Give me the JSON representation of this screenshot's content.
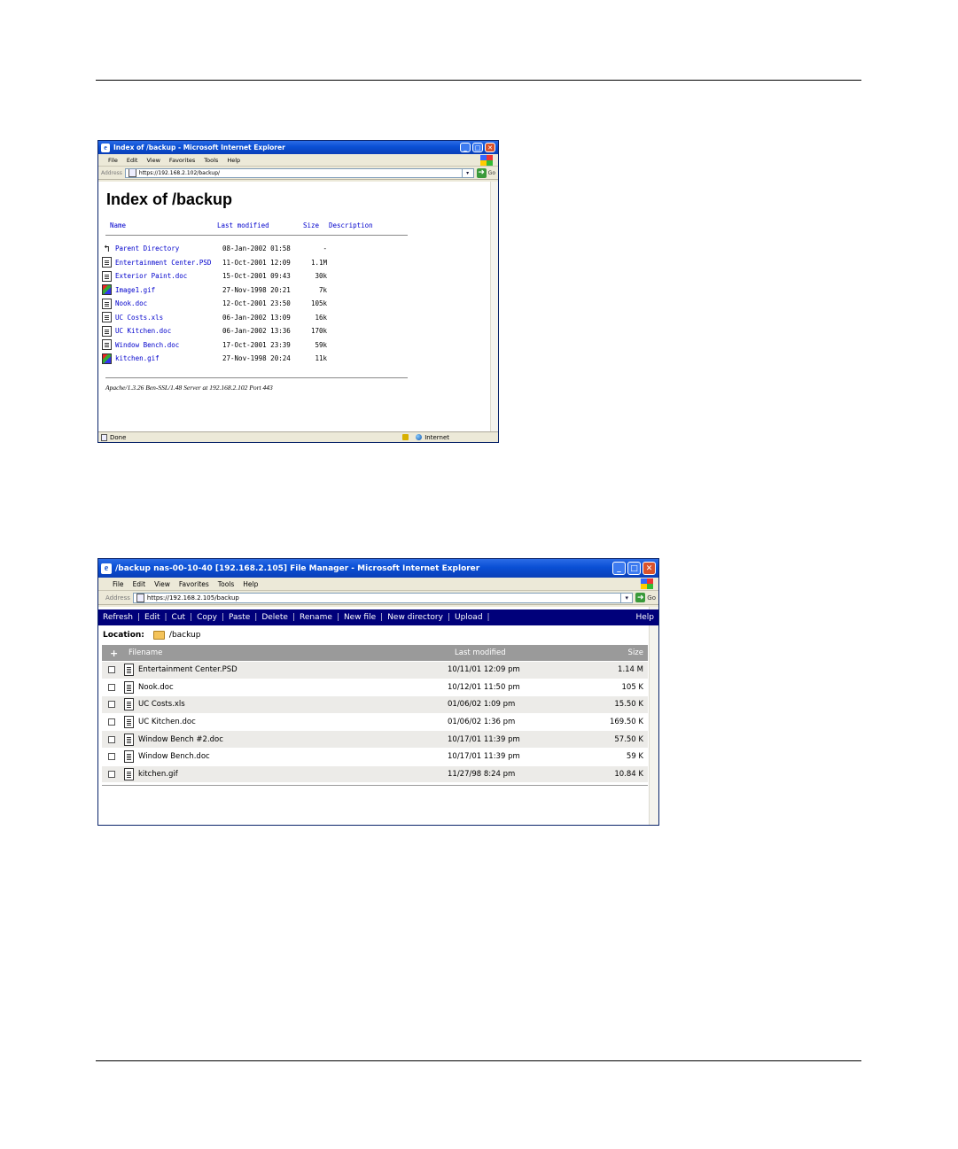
{
  "window1": {
    "title": "Index of /backup - Microsoft Internet Explorer",
    "menu": [
      "File",
      "Edit",
      "View",
      "Favorites",
      "Tools",
      "Help"
    ],
    "address_label": "Address",
    "address": "https://192.168.2.102/backup/",
    "go_label": "Go",
    "heading": "Index of /backup",
    "columns": {
      "name": "Name",
      "modified": "Last modified",
      "size": "Size",
      "description": "Description"
    },
    "rows": [
      {
        "icon": "back",
        "name": "Parent Directory",
        "modified": "08-Jan-2002 01:58",
        "size": "-"
      },
      {
        "icon": "doc",
        "name": "Entertainment Center.PSD",
        "modified": "11-Oct-2001 12:09",
        "size": "1.1M"
      },
      {
        "icon": "doc",
        "name": "Exterior Paint.doc",
        "modified": "15-Oct-2001 09:43",
        "size": "30k"
      },
      {
        "icon": "image",
        "name": "Image1.gif",
        "modified": "27-Nov-1998 20:21",
        "size": "7k"
      },
      {
        "icon": "doc",
        "name": "Nook.doc",
        "modified": "12-Oct-2001 23:50",
        "size": "105k"
      },
      {
        "icon": "doc",
        "name": "UC Costs.xls",
        "modified": "06-Jan-2002 13:09",
        "size": "16k"
      },
      {
        "icon": "doc",
        "name": "UC Kitchen.doc",
        "modified": "06-Jan-2002 13:36",
        "size": "170k"
      },
      {
        "icon": "doc",
        "name": "Window Bench.doc",
        "modified": "17-Oct-2001 23:39",
        "size": "59k"
      },
      {
        "icon": "image",
        "name": "kitchen.gif",
        "modified": "27-Nov-1998 20:24",
        "size": "11k"
      }
    ],
    "footer": "Apache/1.3.26 Ben-SSL/1.48 Server at 192.168.2.102 Port 443",
    "status_left": "Done",
    "status_zone": "Internet"
  },
  "window2": {
    "title": "/backup nas-00-10-40 [192.168.2.105] File Manager - Microsoft Internet Explorer",
    "menu": [
      "File",
      "Edit",
      "View",
      "Favorites",
      "Tools",
      "Help"
    ],
    "address_label": "Address",
    "address": "https://192.168.2.105/backup",
    "go_label": "Go",
    "toolbar": [
      "Refresh",
      "Edit",
      "Cut",
      "Copy",
      "Paste",
      "Delete",
      "Rename",
      "New file",
      "New directory",
      "Upload"
    ],
    "help_label": "Help",
    "location_label": "Location:",
    "location_path": "/backup",
    "columns": {
      "add": "+",
      "filename": "Filename",
      "modified": "Last modified",
      "size": "Size"
    },
    "rows": [
      {
        "name": "Entertainment Center.PSD",
        "modified": "10/11/01 12:09 pm",
        "size": "1.14 M"
      },
      {
        "name": "Nook.doc",
        "modified": "10/12/01 11:50 pm",
        "size": "105 K"
      },
      {
        "name": "UC Costs.xls",
        "modified": "01/06/02 1:09 pm",
        "size": "15.50 K"
      },
      {
        "name": "UC Kitchen.doc",
        "modified": "01/06/02 1:36 pm",
        "size": "169.50 K"
      },
      {
        "name": "Window Bench #2.doc",
        "modified": "10/17/01 11:39 pm",
        "size": "57.50 K"
      },
      {
        "name": "Window Bench.doc",
        "modified": "10/17/01 11:39 pm",
        "size": "59 K"
      },
      {
        "name": "kitchen.gif",
        "modified": "11/27/98 8:24 pm",
        "size": "10.84 K"
      }
    ]
  }
}
